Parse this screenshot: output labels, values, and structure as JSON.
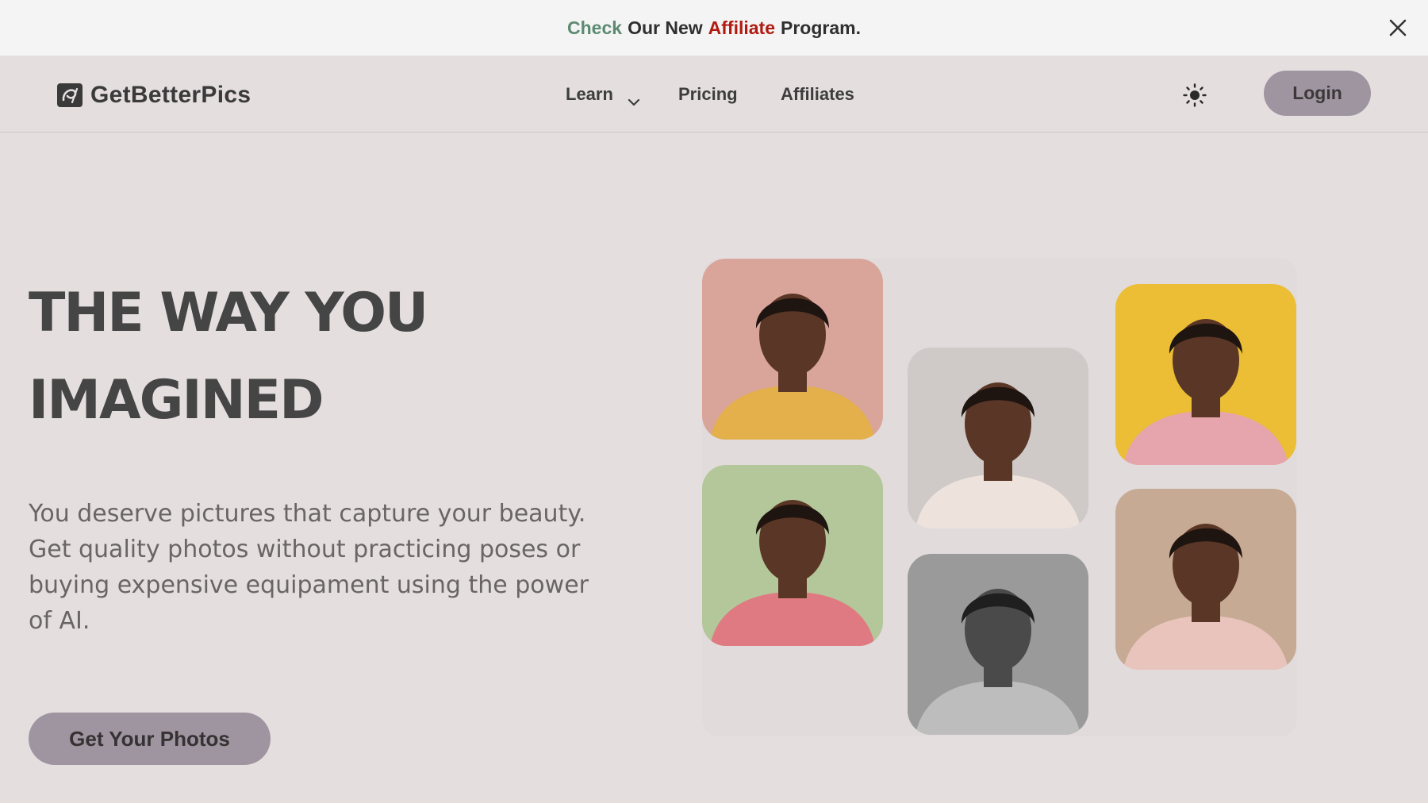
{
  "announcement": {
    "word_check": "Check",
    "word_middle": "Our New",
    "word_affiliate": "Affiliate",
    "word_end": "Program.",
    "check_color": "#5c8a72",
    "affiliate_color": "#b01a10"
  },
  "header": {
    "brand": "GetBetterPics",
    "nav": {
      "learn": "Learn",
      "pricing": "Pricing",
      "affiliates": "Affiliates"
    },
    "theme_icon": "sun-icon",
    "login": "Login"
  },
  "hero": {
    "title_line1": "THE WAY YOU",
    "title_line2": "IMAGINED",
    "subtitle": "You deserve pictures that capture your beauty. Get quality photos without practicing poses or buying expensive equipament using the power of AI.",
    "cta": "Get Your Photos"
  },
  "gallery": {
    "photos": [
      {
        "background": "#d9a49a",
        "sweater": "#e3b04b"
      },
      {
        "background": "#b4c79a",
        "sweater": "#e07a82"
      },
      {
        "background": "#cfcac7",
        "sweater": "#ede3dc"
      },
      {
        "background": "#9a9a9a",
        "sweater": "#bdbdbd"
      },
      {
        "background": "#ebbe35",
        "sweater": "#e6a4ac"
      },
      {
        "background": "#c6aa93",
        "sweater": "#e9c4bd"
      }
    ]
  },
  "colors": {
    "page_bg": "#e4dedf",
    "button_bg": "#9e95a0",
    "banner_bg": "#f4f4f4"
  }
}
